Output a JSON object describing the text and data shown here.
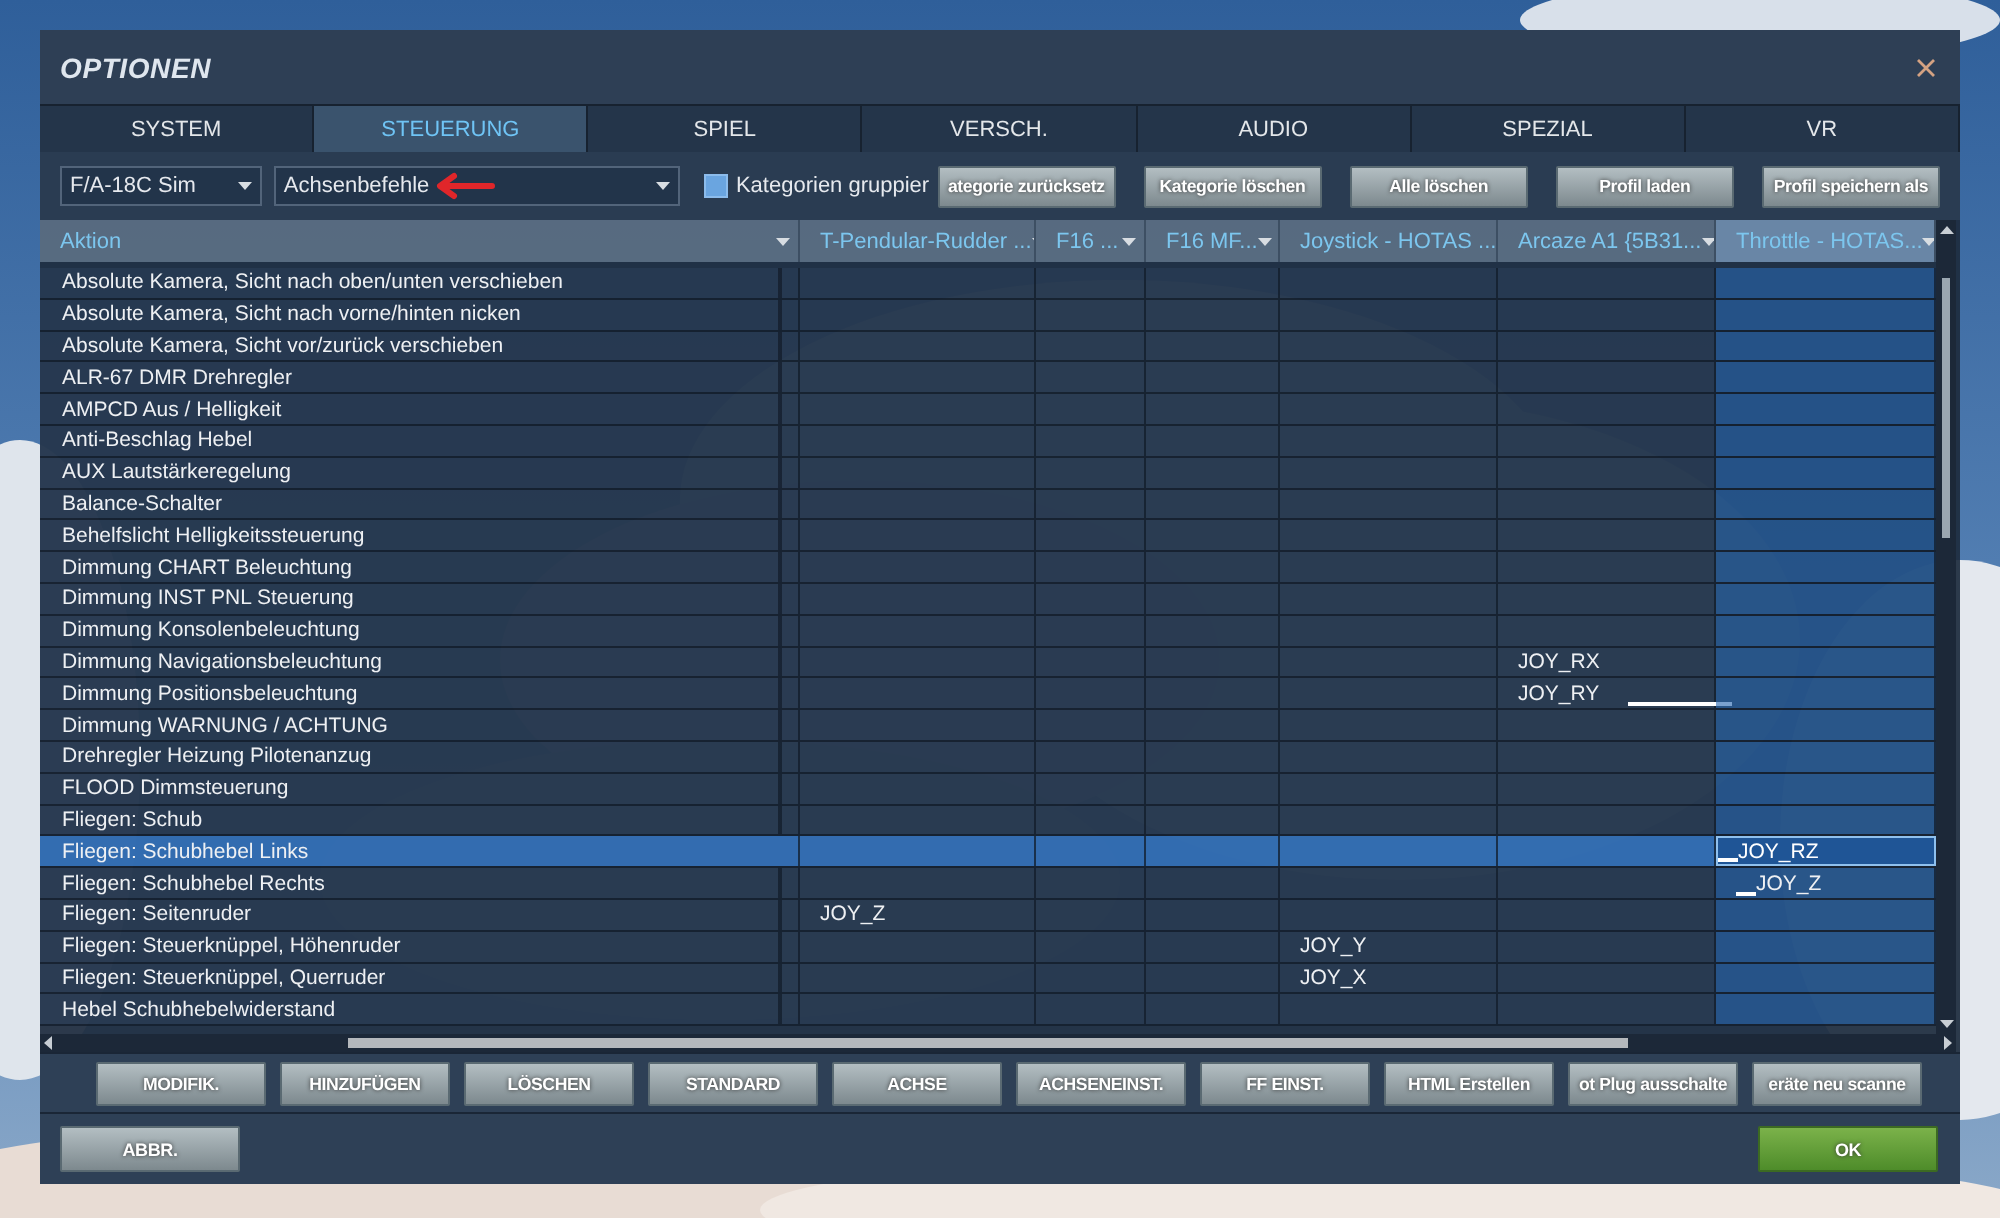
{
  "window": {
    "title": "OPTIONEN"
  },
  "tabs": [
    {
      "label": "SYSTEM",
      "selected": false
    },
    {
      "label": "STEUERUNG",
      "selected": true
    },
    {
      "label": "SPIEL",
      "selected": false
    },
    {
      "label": "VERSCH.",
      "selected": false
    },
    {
      "label": "AUDIO",
      "selected": false
    },
    {
      "label": "SPEZIAL",
      "selected": false
    },
    {
      "label": "VR",
      "selected": false
    }
  ],
  "toolbar": {
    "aircraft": {
      "value": "F/A-18C Sim"
    },
    "category": {
      "value": "Achsenbefehle"
    },
    "group_checkbox": {
      "label": "Kategorien gruppier",
      "checked": false
    },
    "buttons": [
      "ategorie zurücksetz",
      "Kategorie löschen",
      "Alle löschen",
      "Profil laden",
      "Profil speichern als"
    ]
  },
  "table": {
    "columns": [
      {
        "label": "Aktion",
        "selected": false
      },
      {
        "label": "T-Pendular-Rudder ...",
        "selected": false
      },
      {
        "label": "F16 ...",
        "selected": false
      },
      {
        "label": "F16 MF...",
        "selected": false
      },
      {
        "label": "Joystick - HOTAS ...",
        "selected": false
      },
      {
        "label": "Arcaze A1 {5B31...",
        "selected": false
      },
      {
        "label": "Throttle - HOTAS...",
        "selected": true
      }
    ],
    "rows": [
      {
        "selected": false,
        "cells": [
          "Absolute Kamera, Sicht nach oben/unten verschieben",
          "",
          "",
          "",
          "",
          "",
          ""
        ]
      },
      {
        "selected": false,
        "cells": [
          "Absolute Kamera, Sicht nach vorne/hinten nicken",
          "",
          "",
          "",
          "",
          "",
          ""
        ]
      },
      {
        "selected": false,
        "cells": [
          "Absolute Kamera, Sicht vor/zurück verschieben",
          "",
          "",
          "",
          "",
          "",
          ""
        ]
      },
      {
        "selected": false,
        "cells": [
          "ALR-67 DMR Drehregler",
          "",
          "",
          "",
          "",
          "",
          ""
        ]
      },
      {
        "selected": false,
        "cells": [
          "AMPCD Aus / Helligkeit",
          "",
          "",
          "",
          "",
          "",
          ""
        ]
      },
      {
        "selected": false,
        "cells": [
          "Anti-Beschlag Hebel",
          "",
          "",
          "",
          "",
          "",
          ""
        ]
      },
      {
        "selected": false,
        "cells": [
          "AUX Lautstärkeregelung",
          "",
          "",
          "",
          "",
          "",
          ""
        ]
      },
      {
        "selected": false,
        "cells": [
          "Balance-Schalter",
          "",
          "",
          "",
          "",
          "",
          ""
        ]
      },
      {
        "selected": false,
        "cells": [
          "Behelfslicht Helligkeitssteuerung",
          "",
          "",
          "",
          "",
          "",
          ""
        ]
      },
      {
        "selected": false,
        "cells": [
          "Dimmung CHART Beleuchtung",
          "",
          "",
          "",
          "",
          "",
          ""
        ]
      },
      {
        "selected": false,
        "cells": [
          "Dimmung INST PNL Steuerung",
          "",
          "",
          "",
          "",
          "",
          ""
        ]
      },
      {
        "selected": false,
        "cells": [
          "Dimmung Konsolenbeleuchtung",
          "",
          "",
          "",
          "",
          "",
          ""
        ]
      },
      {
        "selected": false,
        "cells": [
          "Dimmung Navigationsbeleuchtung",
          "",
          "",
          "",
          "",
          "JOY_RX",
          ""
        ]
      },
      {
        "selected": false,
        "cells": [
          "Dimmung Positionsbeleuchtung",
          "",
          "",
          "",
          "",
          {
            "text": "JOY_RY",
            "mark_after": true
          },
          ""
        ]
      },
      {
        "selected": false,
        "cells": [
          "Dimmung WARNUNG / ACHTUNG",
          "",
          "",
          "",
          "",
          "",
          ""
        ]
      },
      {
        "selected": false,
        "cells": [
          "Drehregler Heizung Pilotenanzug",
          "",
          "",
          "",
          "",
          "",
          ""
        ]
      },
      {
        "selected": false,
        "cells": [
          "FLOOD Dimmsteuerung",
          "",
          "",
          "",
          "",
          "",
          ""
        ]
      },
      {
        "selected": false,
        "cells": [
          "Fliegen: Schub",
          "",
          "",
          "",
          "",
          "",
          ""
        ]
      },
      {
        "selected": true,
        "cells": [
          "Fliegen: Schubhebel Links",
          "",
          "",
          "",
          "",
          "",
          {
            "text": "JOY_RZ",
            "selected": true,
            "mark_before": true
          }
        ]
      },
      {
        "selected": false,
        "cells": [
          "Fliegen: Schubhebel Rechts",
          "",
          "",
          "",
          "",
          "",
          {
            "text": "JOY_Z",
            "selected": false,
            "mark_before": true
          }
        ]
      },
      {
        "selected": false,
        "cells": [
          "Fliegen: Seitenruder",
          "JOY_Z",
          "",
          "",
          "",
          "",
          ""
        ]
      },
      {
        "selected": false,
        "cells": [
          "Fliegen: Steuerknüppel, Höhenruder",
          "",
          "",
          "",
          "JOY_Y",
          "",
          ""
        ]
      },
      {
        "selected": false,
        "cells": [
          "Fliegen: Steuerknüppel, Querruder",
          "",
          "",
          "",
          "JOY_X",
          "",
          ""
        ]
      },
      {
        "selected": false,
        "cells": [
          "Hebel Schubhebelwiderstand",
          "",
          "",
          "",
          "",
          "",
          ""
        ]
      }
    ]
  },
  "action_buttons": [
    "MODIFIK.",
    "HINZUFÜGEN",
    "LÖSCHEN",
    "STANDARD",
    "ACHSE",
    "ACHSENEINST.",
    "FF EINST.",
    "HTML Erstellen",
    "ot Plug ausschalte",
    "eräte neu scanne"
  ],
  "footer": {
    "cancel": "ABBR.",
    "ok": "OK"
  }
}
